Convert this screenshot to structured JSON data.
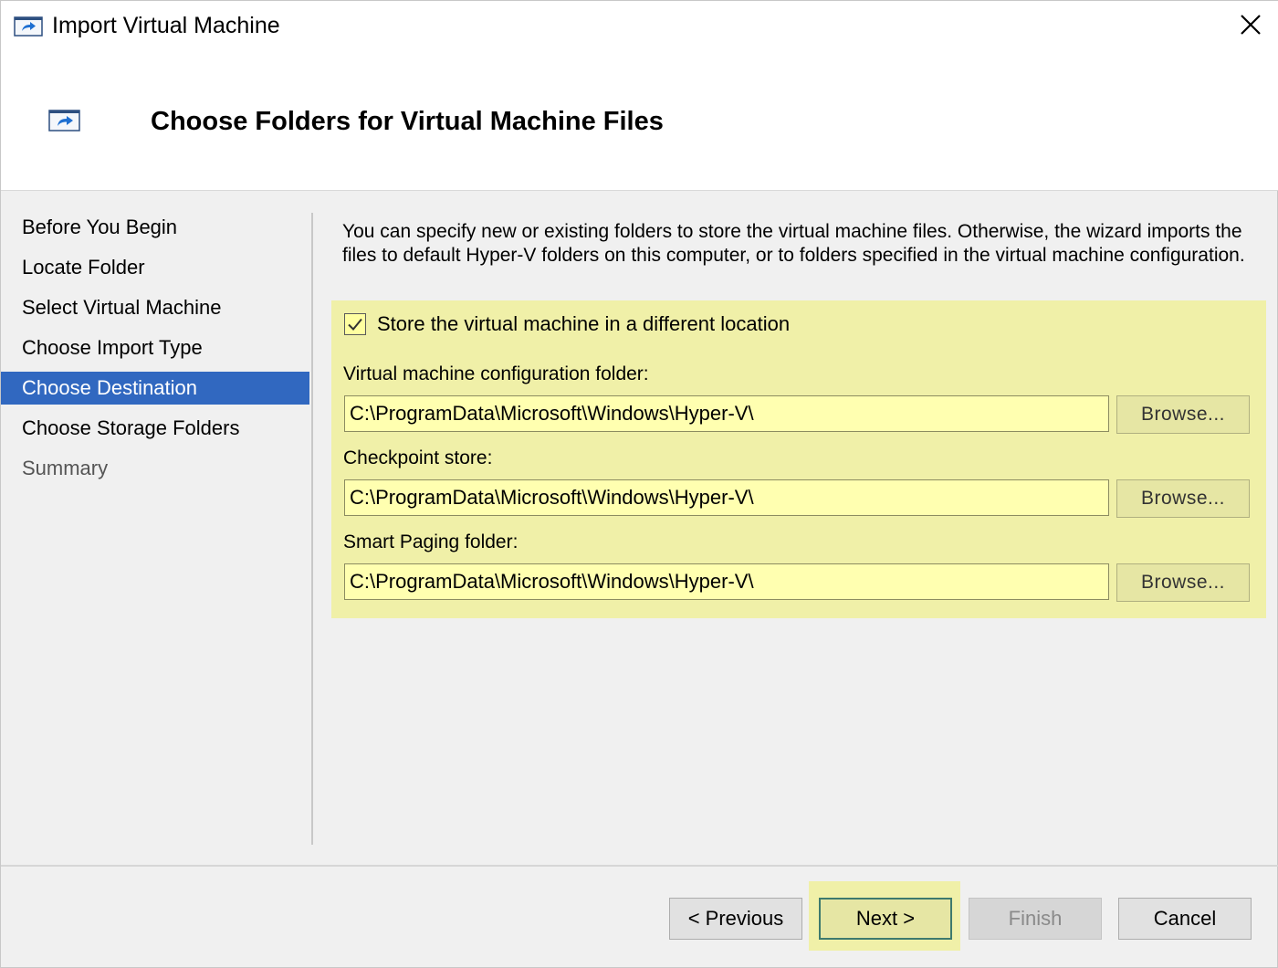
{
  "window": {
    "title": "Import Virtual Machine",
    "close_label": "×"
  },
  "header": {
    "title": "Choose Folders for Virtual Machine Files"
  },
  "nav": {
    "items": [
      {
        "label": "Before You Begin",
        "state": "done"
      },
      {
        "label": "Locate Folder",
        "state": "done"
      },
      {
        "label": "Select Virtual Machine",
        "state": "done"
      },
      {
        "label": "Choose Import Type",
        "state": "done"
      },
      {
        "label": "Choose Destination",
        "state": "active"
      },
      {
        "label": "Choose Storage Folders",
        "state": "done"
      },
      {
        "label": "Summary",
        "state": "future"
      }
    ]
  },
  "content": {
    "description": "You can specify new or existing folders to store the virtual machine files. Otherwise, the wizard imports the files to default Hyper-V folders on this computer, or to folders specified in the virtual machine configuration.",
    "checkbox": {
      "label": "Store the virtual machine in a different location",
      "checked": true
    },
    "fields": {
      "config": {
        "label": "Virtual machine configuration folder:",
        "value": "C:\\ProgramData\\Microsoft\\Windows\\Hyper-V\\",
        "browse_label": "Browse..."
      },
      "checkpoint": {
        "label": "Checkpoint store:",
        "value": "C:\\ProgramData\\Microsoft\\Windows\\Hyper-V\\",
        "browse_label": "Browse..."
      },
      "paging": {
        "label": "Smart Paging folder:",
        "value": "C:\\ProgramData\\Microsoft\\Windows\\Hyper-V\\",
        "browse_label": "Browse..."
      }
    }
  },
  "footer": {
    "previous_label": "< Previous",
    "next_label": "Next >",
    "finish_label": "Finish",
    "cancel_label": "Cancel"
  },
  "colors": {
    "accent": "#3168c0",
    "highlight": "#f0f0a8",
    "input_highlight": "#ffffb0"
  },
  "icons": {
    "window_icon": "import-vm-icon",
    "close_icon": "close-icon",
    "checkbox_icon": "checkmark-icon"
  }
}
